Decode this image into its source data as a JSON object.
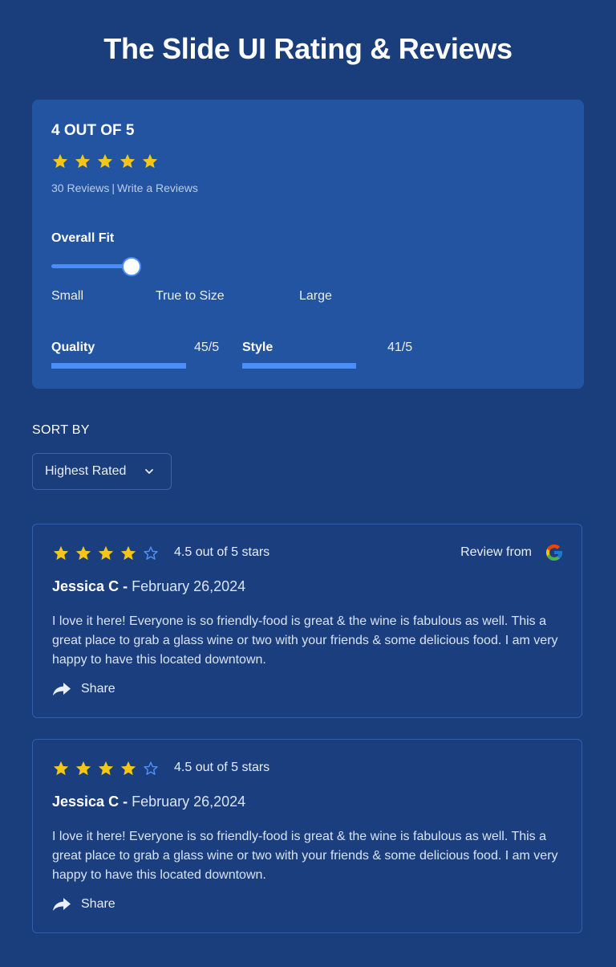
{
  "page": {
    "title": "The Slide UI Rating & Reviews"
  },
  "summary": {
    "score_text": "4 OUT OF 5",
    "stars": {
      "filled": 5,
      "total": 5
    },
    "reviews_count_label": "30 Reviews",
    "separator": "|",
    "write_review_label": "Write a Reviews",
    "fit": {
      "label": "Overall Fit",
      "level_fraction": 0.5,
      "scale": [
        "Small",
        "True to Size",
        "Large"
      ]
    },
    "metrics": [
      {
        "label": "Quality",
        "value": "45/5",
        "fill_fraction": 0.9
      },
      {
        "label": "Style",
        "value": "41/5",
        "fill_fraction": 0.82
      }
    ]
  },
  "sort": {
    "label": "SORT BY",
    "selected": "Highest Rated"
  },
  "reviews": [
    {
      "stars": {
        "filled": 4,
        "total": 5
      },
      "rating_text": "4.5 out of 5 stars",
      "source_label": "Review from",
      "source_icon": "google-icon",
      "name": "Jessica C -",
      "date": "February 26,2024",
      "text": "I love it here! Everyone is so friendly-food is great & the wine is fabulous as well. This a great place to grab a glass wine or two with your friends & some delicious food. I am very happy to have this located downtown.",
      "share_label": "Share"
    },
    {
      "stars": {
        "filled": 4,
        "total": 5
      },
      "rating_text": "4.5 out of 5 stars",
      "name": "Jessica C -",
      "date": "February 26,2024",
      "text": "I love it here! Everyone is so friendly-food is great & the wine is fabulous as well. This a great place to grab a glass wine or two with your friends & some delicious food. I am very happy to have this located downtown.",
      "share_label": "Share"
    }
  ],
  "colors": {
    "background": "#1a3e7b",
    "card": "#2354a2",
    "accent": "#4c8ef7",
    "star": "#f5c518"
  }
}
